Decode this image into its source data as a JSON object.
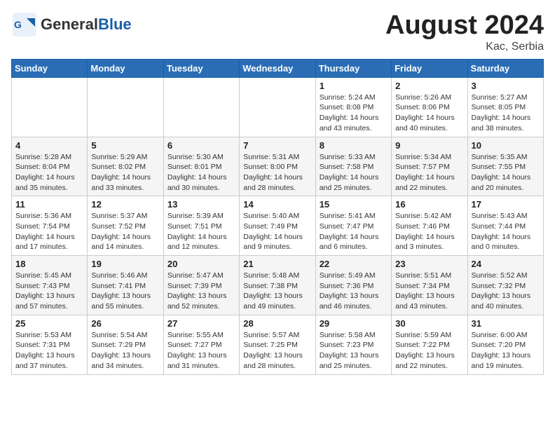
{
  "header": {
    "logo_general": "General",
    "logo_blue": "Blue",
    "month_year": "August 2024",
    "location": "Kac, Serbia"
  },
  "weekdays": [
    "Sunday",
    "Monday",
    "Tuesday",
    "Wednesday",
    "Thursday",
    "Friday",
    "Saturday"
  ],
  "weeks": [
    [
      {
        "day": "",
        "info": ""
      },
      {
        "day": "",
        "info": ""
      },
      {
        "day": "",
        "info": ""
      },
      {
        "day": "",
        "info": ""
      },
      {
        "day": "1",
        "info": "Sunrise: 5:24 AM\nSunset: 8:08 PM\nDaylight: 14 hours\nand 43 minutes."
      },
      {
        "day": "2",
        "info": "Sunrise: 5:26 AM\nSunset: 8:06 PM\nDaylight: 14 hours\nand 40 minutes."
      },
      {
        "day": "3",
        "info": "Sunrise: 5:27 AM\nSunset: 8:05 PM\nDaylight: 14 hours\nand 38 minutes."
      }
    ],
    [
      {
        "day": "4",
        "info": "Sunrise: 5:28 AM\nSunset: 8:04 PM\nDaylight: 14 hours\nand 35 minutes."
      },
      {
        "day": "5",
        "info": "Sunrise: 5:29 AM\nSunset: 8:02 PM\nDaylight: 14 hours\nand 33 minutes."
      },
      {
        "day": "6",
        "info": "Sunrise: 5:30 AM\nSunset: 8:01 PM\nDaylight: 14 hours\nand 30 minutes."
      },
      {
        "day": "7",
        "info": "Sunrise: 5:31 AM\nSunset: 8:00 PM\nDaylight: 14 hours\nand 28 minutes."
      },
      {
        "day": "8",
        "info": "Sunrise: 5:33 AM\nSunset: 7:58 PM\nDaylight: 14 hours\nand 25 minutes."
      },
      {
        "day": "9",
        "info": "Sunrise: 5:34 AM\nSunset: 7:57 PM\nDaylight: 14 hours\nand 22 minutes."
      },
      {
        "day": "10",
        "info": "Sunrise: 5:35 AM\nSunset: 7:55 PM\nDaylight: 14 hours\nand 20 minutes."
      }
    ],
    [
      {
        "day": "11",
        "info": "Sunrise: 5:36 AM\nSunset: 7:54 PM\nDaylight: 14 hours\nand 17 minutes."
      },
      {
        "day": "12",
        "info": "Sunrise: 5:37 AM\nSunset: 7:52 PM\nDaylight: 14 hours\nand 14 minutes."
      },
      {
        "day": "13",
        "info": "Sunrise: 5:39 AM\nSunset: 7:51 PM\nDaylight: 14 hours\nand 12 minutes."
      },
      {
        "day": "14",
        "info": "Sunrise: 5:40 AM\nSunset: 7:49 PM\nDaylight: 14 hours\nand 9 minutes."
      },
      {
        "day": "15",
        "info": "Sunrise: 5:41 AM\nSunset: 7:47 PM\nDaylight: 14 hours\nand 6 minutes."
      },
      {
        "day": "16",
        "info": "Sunrise: 5:42 AM\nSunset: 7:46 PM\nDaylight: 14 hours\nand 3 minutes."
      },
      {
        "day": "17",
        "info": "Sunrise: 5:43 AM\nSunset: 7:44 PM\nDaylight: 14 hours\nand 0 minutes."
      }
    ],
    [
      {
        "day": "18",
        "info": "Sunrise: 5:45 AM\nSunset: 7:43 PM\nDaylight: 13 hours\nand 57 minutes."
      },
      {
        "day": "19",
        "info": "Sunrise: 5:46 AM\nSunset: 7:41 PM\nDaylight: 13 hours\nand 55 minutes."
      },
      {
        "day": "20",
        "info": "Sunrise: 5:47 AM\nSunset: 7:39 PM\nDaylight: 13 hours\nand 52 minutes."
      },
      {
        "day": "21",
        "info": "Sunrise: 5:48 AM\nSunset: 7:38 PM\nDaylight: 13 hours\nand 49 minutes."
      },
      {
        "day": "22",
        "info": "Sunrise: 5:49 AM\nSunset: 7:36 PM\nDaylight: 13 hours\nand 46 minutes."
      },
      {
        "day": "23",
        "info": "Sunrise: 5:51 AM\nSunset: 7:34 PM\nDaylight: 13 hours\nand 43 minutes."
      },
      {
        "day": "24",
        "info": "Sunrise: 5:52 AM\nSunset: 7:32 PM\nDaylight: 13 hours\nand 40 minutes."
      }
    ],
    [
      {
        "day": "25",
        "info": "Sunrise: 5:53 AM\nSunset: 7:31 PM\nDaylight: 13 hours\nand 37 minutes."
      },
      {
        "day": "26",
        "info": "Sunrise: 5:54 AM\nSunset: 7:29 PM\nDaylight: 13 hours\nand 34 minutes."
      },
      {
        "day": "27",
        "info": "Sunrise: 5:55 AM\nSunset: 7:27 PM\nDaylight: 13 hours\nand 31 minutes."
      },
      {
        "day": "28",
        "info": "Sunrise: 5:57 AM\nSunset: 7:25 PM\nDaylight: 13 hours\nand 28 minutes."
      },
      {
        "day": "29",
        "info": "Sunrise: 5:58 AM\nSunset: 7:23 PM\nDaylight: 13 hours\nand 25 minutes."
      },
      {
        "day": "30",
        "info": "Sunrise: 5:59 AM\nSunset: 7:22 PM\nDaylight: 13 hours\nand 22 minutes."
      },
      {
        "day": "31",
        "info": "Sunrise: 6:00 AM\nSunset: 7:20 PM\nDaylight: 13 hours\nand 19 minutes."
      }
    ]
  ]
}
